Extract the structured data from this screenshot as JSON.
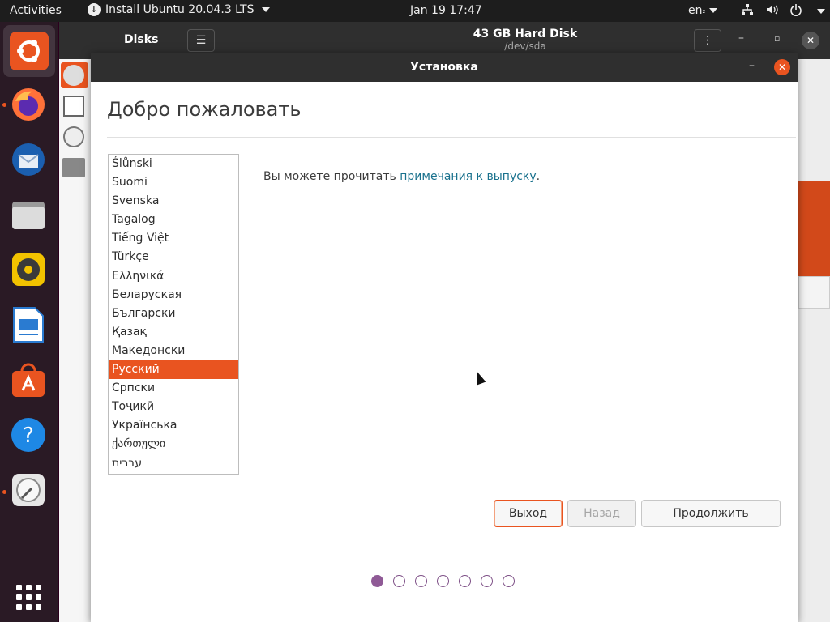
{
  "topbar": {
    "activities": "Activities",
    "app_menu": "Install Ubuntu 20.04.3 LTS",
    "clock": "Jan 19  17:47",
    "input_lang": "en",
    "status_icons": [
      "network-icon",
      "volume-icon",
      "power-icon"
    ]
  },
  "dock": {
    "items": [
      {
        "name": "ubiquity-installer",
        "icon": "ubuntu-icon",
        "color": "#e95420"
      },
      {
        "name": "firefox",
        "icon": "firefox-icon",
        "color": "#ff7139"
      },
      {
        "name": "thunderbird",
        "icon": "thunderbird-icon",
        "color": "#2b6cb8"
      },
      {
        "name": "files",
        "icon": "folder-icon",
        "color": "#c9c9c9"
      },
      {
        "name": "rhythmbox",
        "icon": "speaker-icon",
        "color": "#f2c200"
      },
      {
        "name": "libreoffice-writer",
        "icon": "document-icon",
        "color": "#2a7bd1"
      },
      {
        "name": "ubuntu-software",
        "icon": "software-bag-icon",
        "color": "#e95420"
      },
      {
        "name": "help",
        "icon": "help-icon",
        "color": "#1e88e5"
      },
      {
        "name": "disks",
        "icon": "disk-icon",
        "color": "#d0d0d0"
      }
    ],
    "show_apps": "grid-icon"
  },
  "disks_window": {
    "title": "Disks",
    "disk_title": "43 GB Hard Disk",
    "disk_path": "/dev/sda"
  },
  "installer": {
    "window_title": "Установка",
    "heading": "Добро пожаловать",
    "languages": [
      "Ślůnski",
      "Suomi",
      "Svenska",
      "Tagalog",
      "Tiếng Việt",
      "Türkçe",
      "Ελληνικά",
      "Беларуская",
      "Български",
      "Қазақ",
      "Македонски",
      "Русский",
      "Српски",
      "Тоҷикӣ",
      "Українська",
      "ქართული",
      "עברית"
    ],
    "selected_language": "Русский",
    "release_text": "Вы можете прочитать ",
    "release_link": "примечания к выпуску",
    "release_end": ".",
    "buttons": {
      "quit": "Выход",
      "back": "Назад",
      "continue": "Продолжить"
    },
    "progress": {
      "total_steps": 7,
      "current_step": 1
    }
  },
  "colors": {
    "accent": "#e95420",
    "progress": "#8f5a96",
    "link": "#19718d"
  }
}
